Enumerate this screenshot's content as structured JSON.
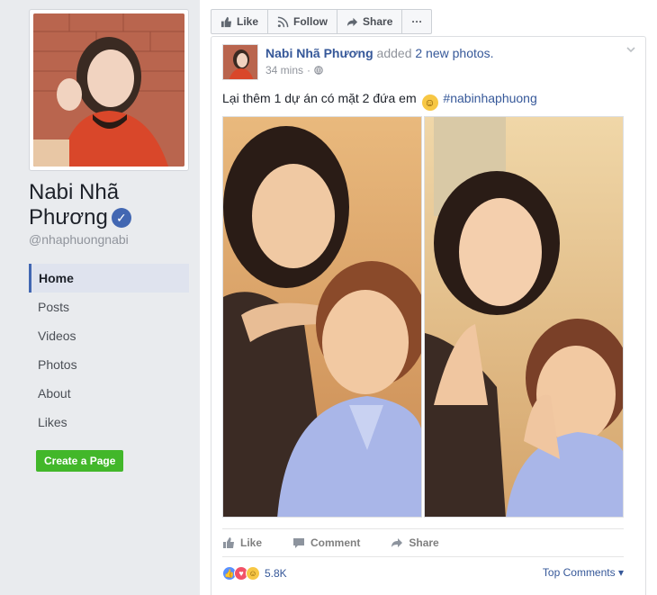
{
  "sidebar": {
    "page_name_line1": "Nabi Nhã",
    "page_name_line2": "Phương",
    "verified_glyph": "✓",
    "handle": "@nhaphuongnabi",
    "nav": [
      {
        "label": "Home",
        "active": true
      },
      {
        "label": "Posts",
        "active": false
      },
      {
        "label": "Videos",
        "active": false
      },
      {
        "label": "Photos",
        "active": false
      },
      {
        "label": "About",
        "active": false
      },
      {
        "label": "Likes",
        "active": false
      }
    ],
    "create_page_label": "Create a Page"
  },
  "action_bar": {
    "like": "Like",
    "follow": "Follow",
    "share": "Share",
    "more": "···"
  },
  "post": {
    "author": "Nabi Nhã Phương",
    "action_text": "added",
    "action_link": "2 new photos.",
    "time": "34 mins",
    "privacy_icon": "globe-icon",
    "caption_text": "Lại thêm 1 dự án có mặt 2 đứa em",
    "caption_emoji": "smile-emoji",
    "hashtag": "#nabinhaphuong",
    "actions": {
      "like": "Like",
      "comment": "Comment",
      "share": "Share"
    },
    "reaction_count": "5.8K",
    "top_comments": "Top Comments"
  },
  "colors": {
    "accent": "#4267b2",
    "link": "#365899",
    "create_button": "#42b72a",
    "background": "#e9ebee"
  }
}
